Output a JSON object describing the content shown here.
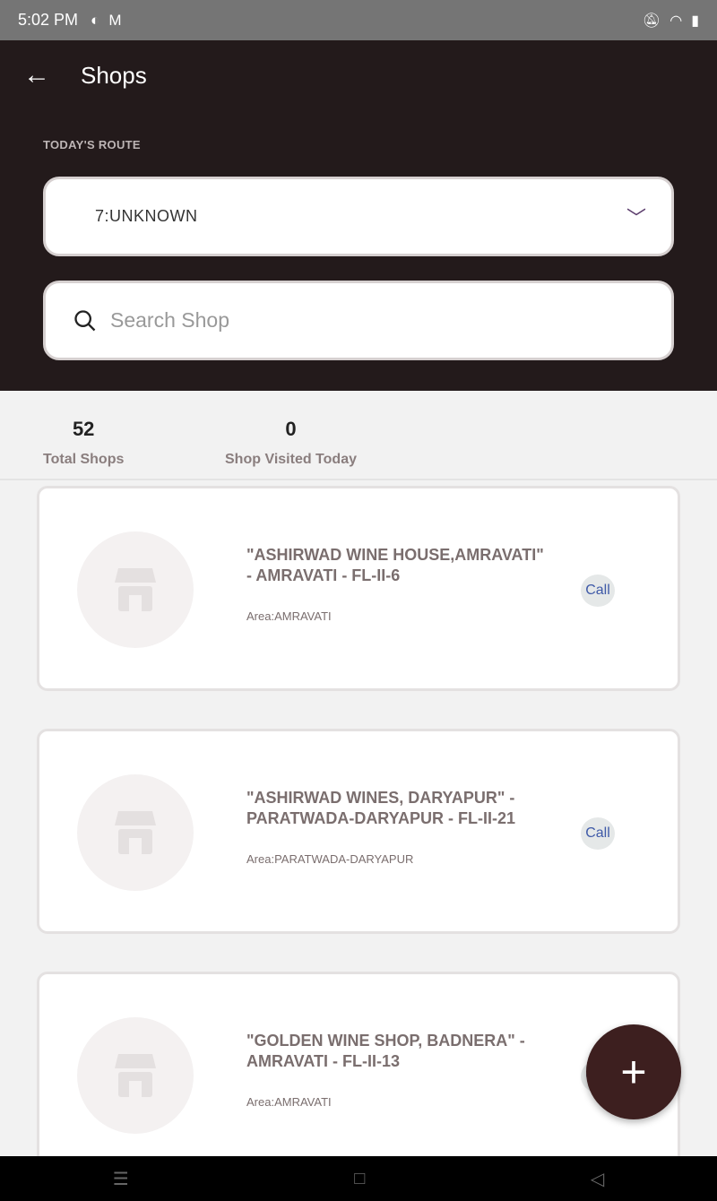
{
  "status_bar": {
    "time": "5:02 PM",
    "icons": [
      "p-app-icon",
      "gmail-icon",
      "notifications-off-icon",
      "wifi-icon",
      "battery-icon"
    ]
  },
  "header": {
    "title": "Shops",
    "route_label": "TODAY'S ROUTE",
    "route_value": "7:UNKNOWN",
    "search_placeholder": "Search Shop",
    "back_icon": "arrow-left-icon"
  },
  "stats": {
    "total_shops": "52",
    "total_shops_label": "Total Shops",
    "visited": "0",
    "visited_label": "Shop Visited Today"
  },
  "shops": [
    {
      "name": "\"ASHIRWAD WINE HOUSE,AMRAVATI\" - AMRAVATI - FL-II-6",
      "area": "Area:AMRAVATI",
      "call": "Call"
    },
    {
      "name": "\"ASHIRWAD WINES, DARYAPUR\" - PARATWADA-DARYAPUR - FL-II-21",
      "area": "Area:PARATWADA-DARYAPUR",
      "call": "Call"
    },
    {
      "name": "\"GOLDEN WINE SHOP, BADNERA\" - AMRAVATI - FL-II-13",
      "area": "Area:AMRAVATI",
      "call": "Call"
    }
  ],
  "colors": {
    "header": "#231a1b",
    "fab": "#3d1f1f",
    "call_text": "#3f5aa8"
  }
}
